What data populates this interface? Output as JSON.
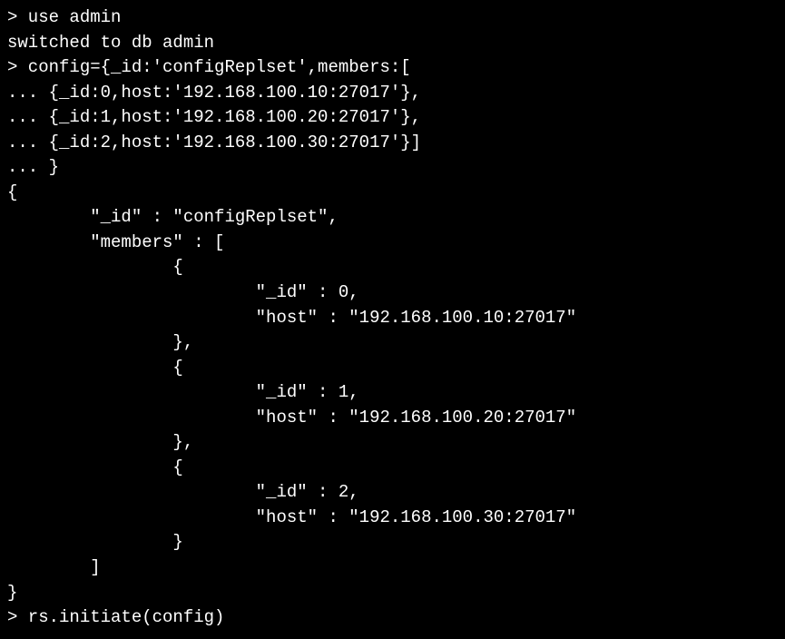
{
  "terminal": {
    "lines": [
      "> use admin",
      "switched to db admin",
      "> config={_id:'configReplset',members:[",
      "... {_id:0,host:'192.168.100.10:27017'},",
      "... {_id:1,host:'192.168.100.20:27017'},",
      "... {_id:2,host:'192.168.100.30:27017'}]",
      "... }",
      "{",
      "        \"_id\" : \"configReplset\",",
      "        \"members\" : [",
      "                {",
      "                        \"_id\" : 0,",
      "                        \"host\" : \"192.168.100.10:27017\"",
      "                },",
      "                {",
      "                        \"_id\" : 1,",
      "                        \"host\" : \"192.168.100.20:27017\"",
      "                },",
      "                {",
      "                        \"_id\" : 2,",
      "                        \"host\" : \"192.168.100.30:27017\"",
      "                }",
      "        ]",
      "}",
      "> rs.initiate(config)"
    ]
  },
  "commands": {
    "use_db": "use admin",
    "switch_response": "switched to db admin",
    "config_assignment": "config={_id:'configReplset',members:[...]}",
    "initiate": "rs.initiate(config)"
  },
  "config_object": {
    "_id": "configReplset",
    "members": [
      {
        "_id": 0,
        "host": "192.168.100.10:27017"
      },
      {
        "_id": 1,
        "host": "192.168.100.20:27017"
      },
      {
        "_id": 2,
        "host": "192.168.100.30:27017"
      }
    ]
  }
}
